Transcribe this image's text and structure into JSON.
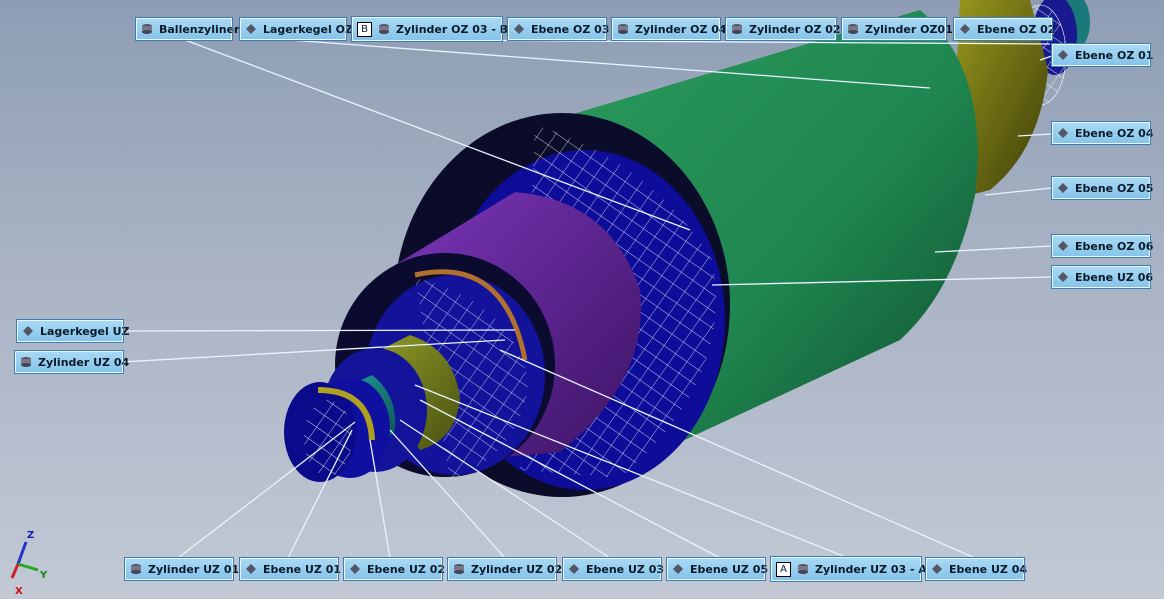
{
  "top_tags": [
    {
      "label": "Ballenzyliner",
      "icon": "cylinder-icon"
    },
    {
      "label": "Lagerkegel OZ",
      "icon": "plane-icon"
    },
    {
      "label": "Zylinder OZ 03 - B",
      "icon": "cylinder-icon",
      "box": "B"
    },
    {
      "label": "Ebene OZ 03",
      "icon": "plane-icon"
    },
    {
      "label": "Zylinder OZ 04",
      "icon": "cylinder-icon"
    },
    {
      "label": "Zylinder OZ 02",
      "icon": "cylinder-icon"
    },
    {
      "label": "Zylinder OZ01",
      "icon": "cylinder-icon"
    },
    {
      "label": "Ebene OZ 02",
      "icon": "plane-icon"
    }
  ],
  "right_tags": [
    {
      "label": "Ebene OZ 01",
      "icon": "plane-icon"
    },
    {
      "label": "Ebene OZ 04",
      "icon": "plane-icon"
    },
    {
      "label": "Ebene OZ 05",
      "icon": "plane-icon"
    },
    {
      "label": "Ebene OZ 06",
      "icon": "plane-icon"
    },
    {
      "label": "Ebene UZ 06",
      "icon": "plane-icon"
    }
  ],
  "left_tags": [
    {
      "label": "Lagerkegel UZ",
      "icon": "plane-icon"
    },
    {
      "label": "Zylinder UZ 04",
      "icon": "cylinder-icon"
    }
  ],
  "bottom_tags": [
    {
      "label": "Zylinder UZ 01",
      "icon": "cylinder-icon"
    },
    {
      "label": "Ebene UZ 01",
      "icon": "plane-icon"
    },
    {
      "label": "Ebene UZ 02",
      "icon": "plane-icon"
    },
    {
      "label": "Zylinder UZ 02",
      "icon": "cylinder-icon"
    },
    {
      "label": "Ebene UZ 03",
      "icon": "plane-icon"
    },
    {
      "label": "Ebene UZ 05",
      "icon": "plane-icon"
    },
    {
      "label": "Zylinder UZ 03 - A",
      "icon": "cylinder-icon",
      "box": "A"
    },
    {
      "label": "Ebene UZ 04",
      "icon": "plane-icon"
    }
  ],
  "axis_triad": {
    "z": "Z",
    "y": "Y",
    "x": "X"
  },
  "colors": {
    "background_top": "#8e9db4",
    "background_bottom": "#c2c9d5",
    "main_cylinder": "#1f8a52",
    "bearing_face": "#0c0c9a",
    "journal_purple": "#6a2fa0",
    "journal_olive": "#7e8a1a",
    "journal_teal": "#1a8a8a",
    "tag_fill": "#96cff0",
    "leader_line": "#e8f4ff"
  }
}
